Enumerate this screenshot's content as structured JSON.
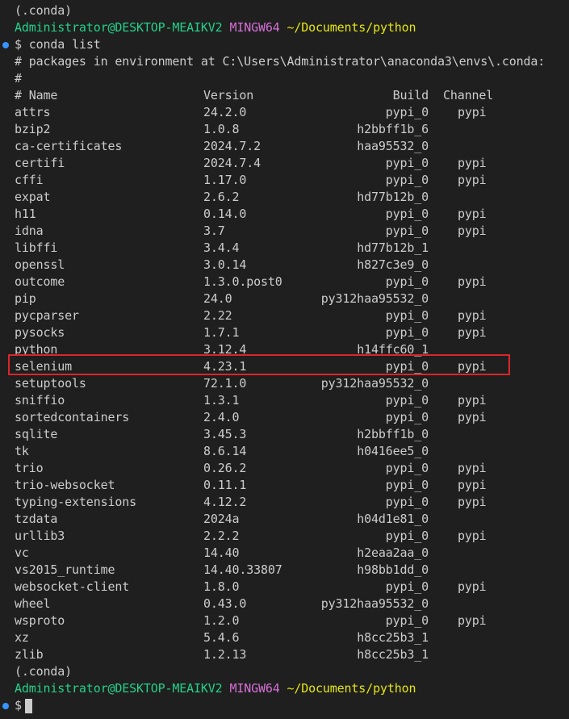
{
  "prompt": {
    "env": "(.conda)",
    "user_host": "Administrator@DESKTOP-MEAIKV2",
    "shell": "MINGW64",
    "cwd": "~/Documents/python",
    "symbol": "$",
    "command": "conda list"
  },
  "listing_comment": "# packages in environment at C:\\Users\\Administrator\\anaconda3\\envs\\.conda:",
  "blank_comment": "#",
  "headers": {
    "name": "# Name",
    "version": "Version",
    "build": "Build",
    "channel": "Channel"
  },
  "packages": [
    {
      "name": "attrs",
      "version": "24.2.0",
      "build": "pypi_0",
      "channel": "pypi"
    },
    {
      "name": "bzip2",
      "version": "1.0.8",
      "build": "h2bbff1b_6",
      "channel": ""
    },
    {
      "name": "ca-certificates",
      "version": "2024.7.2",
      "build": "haa95532_0",
      "channel": ""
    },
    {
      "name": "certifi",
      "version": "2024.7.4",
      "build": "pypi_0",
      "channel": "pypi"
    },
    {
      "name": "cffi",
      "version": "1.17.0",
      "build": "pypi_0",
      "channel": "pypi"
    },
    {
      "name": "expat",
      "version": "2.6.2",
      "build": "hd77b12b_0",
      "channel": ""
    },
    {
      "name": "h11",
      "version": "0.14.0",
      "build": "pypi_0",
      "channel": "pypi"
    },
    {
      "name": "idna",
      "version": "3.7",
      "build": "pypi_0",
      "channel": "pypi"
    },
    {
      "name": "libffi",
      "version": "3.4.4",
      "build": "hd77b12b_1",
      "channel": ""
    },
    {
      "name": "openssl",
      "version": "3.0.14",
      "build": "h827c3e9_0",
      "channel": ""
    },
    {
      "name": "outcome",
      "version": "1.3.0.post0",
      "build": "pypi_0",
      "channel": "pypi"
    },
    {
      "name": "pip",
      "version": "24.0",
      "build": "py312haa95532_0",
      "channel": ""
    },
    {
      "name": "pycparser",
      "version": "2.22",
      "build": "pypi_0",
      "channel": "pypi"
    },
    {
      "name": "pysocks",
      "version": "1.7.1",
      "build": "pypi_0",
      "channel": "pypi"
    },
    {
      "name": "python",
      "version": "3.12.4",
      "build": "h14ffc60_1",
      "channel": ""
    },
    {
      "name": "selenium",
      "version": "4.23.1",
      "build": "pypi_0",
      "channel": "pypi"
    },
    {
      "name": "setuptools",
      "version": "72.1.0",
      "build": "py312haa95532_0",
      "channel": ""
    },
    {
      "name": "sniffio",
      "version": "1.3.1",
      "build": "pypi_0",
      "channel": "pypi"
    },
    {
      "name": "sortedcontainers",
      "version": "2.4.0",
      "build": "pypi_0",
      "channel": "pypi"
    },
    {
      "name": "sqlite",
      "version": "3.45.3",
      "build": "h2bbff1b_0",
      "channel": ""
    },
    {
      "name": "tk",
      "version": "8.6.14",
      "build": "h0416ee5_0",
      "channel": ""
    },
    {
      "name": "trio",
      "version": "0.26.2",
      "build": "pypi_0",
      "channel": "pypi"
    },
    {
      "name": "trio-websocket",
      "version": "0.11.1",
      "build": "pypi_0",
      "channel": "pypi"
    },
    {
      "name": "typing-extensions",
      "version": "4.12.2",
      "build": "pypi_0",
      "channel": "pypi"
    },
    {
      "name": "tzdata",
      "version": "2024a",
      "build": "h04d1e81_0",
      "channel": ""
    },
    {
      "name": "urllib3",
      "version": "2.2.2",
      "build": "pypi_0",
      "channel": "pypi"
    },
    {
      "name": "vc",
      "version": "14.40",
      "build": "h2eaa2aa_0",
      "channel": ""
    },
    {
      "name": "vs2015_runtime",
      "version": "14.40.33807",
      "build": "h98bb1dd_0",
      "channel": ""
    },
    {
      "name": "websocket-client",
      "version": "1.8.0",
      "build": "pypi_0",
      "channel": "pypi"
    },
    {
      "name": "wheel",
      "version": "0.43.0",
      "build": "py312haa95532_0",
      "channel": ""
    },
    {
      "name": "wsproto",
      "version": "1.2.0",
      "build": "pypi_0",
      "channel": "pypi"
    },
    {
      "name": "xz",
      "version": "5.4.6",
      "build": "h8cc25b3_1",
      "channel": ""
    },
    {
      "name": "zlib",
      "version": "1.2.13",
      "build": "h8cc25b3_1",
      "channel": ""
    }
  ],
  "highlighted_package": "selenium",
  "colors": {
    "background": "#1f1f1f",
    "text": "#cccccc",
    "user_host": "#23d18b",
    "shell": "#d670d6",
    "cwd": "#e5e510",
    "highlight_border": "#d9262b"
  }
}
